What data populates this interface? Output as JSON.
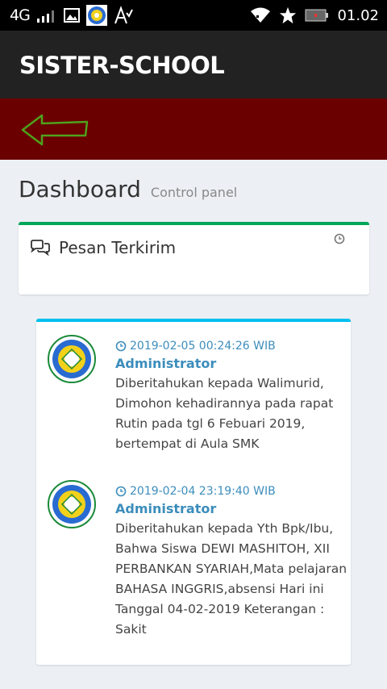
{
  "status_bar": {
    "network_label": "4G",
    "time": "01.02",
    "icons": [
      "signal-icon",
      "gallery-icon",
      "app-logo-icon",
      "font-icon",
      "wifi-icon",
      "star-icon",
      "battery-icon"
    ]
  },
  "app": {
    "title": "SISTER-SCHOOL"
  },
  "nav": {
    "back_icon": "back-arrow-icon"
  },
  "page": {
    "title": "Dashboard",
    "subtitle": "Control panel"
  },
  "sent_box": {
    "label": "Pesan Terkirim",
    "icons": [
      "comments-icon",
      "clock-icon"
    ]
  },
  "messages": [
    {
      "time": "2019-02-05 00:24:26 WIB",
      "author": "Administrator",
      "text": "Diberitahukan kepada Walimurid, Dimohon kehadirannya pada rapat Rutin pada tgl 6 Febuari 2019, bertempat di Aula SMK"
    },
    {
      "time": "2019-02-04 23:19:40 WIB",
      "author": "Administrator",
      "text": "Diberitahukan kepada Yth Bpk/Ibu, Bahwa Siswa DEWI MASHITOH, XII PERBANKAN SYARIAH,Mata pelajaran BAHASA INGGRIS,absensi Hari ini Tanggal 04-02-2019 Keterangan : Sakit"
    }
  ],
  "colors": {
    "appbar": "#222222",
    "redbar": "#6a0000",
    "success_border": "#00a65a",
    "info_border": "#00c0ef",
    "link": "#3c8dbc"
  }
}
